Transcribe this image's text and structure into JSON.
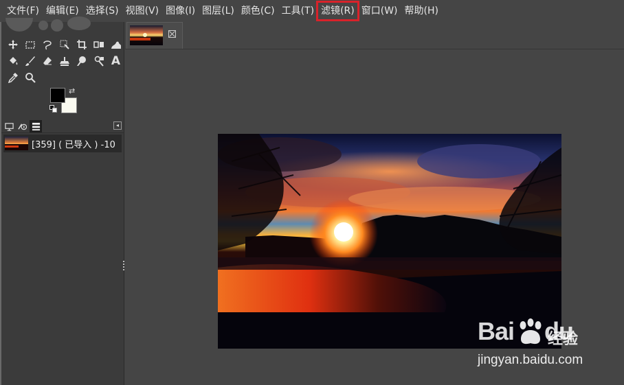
{
  "menubar": {
    "items": [
      "文件(F)",
      "编辑(E)",
      "选择(S)",
      "视图(V)",
      "图像(I)",
      "图层(L)",
      "颜色(C)",
      "工具(T)",
      "滤镜(R)",
      "窗口(W)",
      "帮助(H)"
    ],
    "highlighted_index": 8
  },
  "toolbox": {
    "tools_row1": [
      "move-tool-icon",
      "rect-select-icon",
      "free-select-icon",
      "fuzzy-select-icon",
      "crop-icon",
      "unified-transform-icon",
      "warp-transform-icon"
    ],
    "tools_row2": [
      "bucket-fill-icon",
      "paintbrush-icon",
      "eraser-icon",
      "clone-icon",
      "smudge-icon",
      "dodge-burn-icon",
      "text-tool-icon"
    ],
    "tools_row3": [
      "color-picker-icon",
      "zoom-icon"
    ],
    "text_tool_glyph": "A",
    "foreground_color": "#000000",
    "background_color": "#fafaf0"
  },
  "dock": {
    "tabs": [
      "device-status-icon",
      "tool-options-icon",
      "images-icon"
    ],
    "active_tab": 2,
    "image_list": [
      {
        "label": "[359] ( 已导入 ) -10"
      }
    ]
  },
  "image_tabs": [
    {
      "name": "sunset-image-tab"
    }
  ],
  "watermark": {
    "logo": "Bai",
    "logo_suffix": "du",
    "brand": "经验",
    "url": "jingyan.baidu.com"
  },
  "colors": {
    "highlight": "#d9222a",
    "ui_background": "#454545",
    "panel_background": "#3b3b3b"
  }
}
